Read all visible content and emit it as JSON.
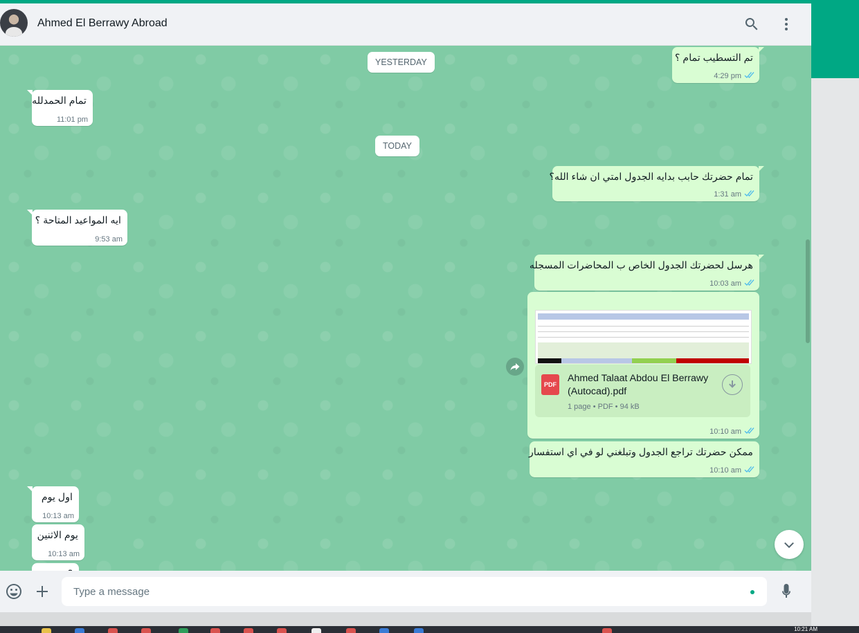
{
  "header": {
    "contact_name": "Ahmed El Berrawy Abroad",
    "icons": [
      "search-icon",
      "menu-icon"
    ]
  },
  "chat": {
    "date_yesterday": "YESTERDAY",
    "date_today": "TODAY",
    "messages": [
      {
        "direction": "out",
        "text": "تم التسطيب تمام ؟",
        "time": "4:29 pm",
        "status": "read"
      },
      {
        "direction": "in",
        "text": "تمام الحمدلله",
        "time": "11:01 pm"
      },
      {
        "direction": "out",
        "text": "تمام حضرتك حابب بدايه الجدول امتي ان شاء الله؟",
        "time": "1:31 am",
        "status": "read"
      },
      {
        "direction": "in",
        "text": "ايه المواعيد المتاحة ؟",
        "time": "9:53 am"
      },
      {
        "direction": "out",
        "text": "هرسل لحضرتك الجدول الخاص ب المحاضرات المسجله",
        "time": "10:03 am",
        "status": "read"
      },
      {
        "direction": "out",
        "type": "document",
        "file_name": "Ahmed Talaat Abdou El Berrawy (Autocad).pdf",
        "file_info": "1 page • PDF • 94 kB",
        "file_icon_label": "PDF",
        "time": "10:10 am",
        "status": "read"
      },
      {
        "direction": "out",
        "text": "ممكن حضرتك تراجع الجدول وتبلغني لو في اي استفسار",
        "time": "10:10 am",
        "status": "read"
      },
      {
        "direction": "in",
        "text": "اول يوم",
        "time": "10:13 am"
      },
      {
        "direction": "in",
        "text": "يوم الاثنين",
        "time": "10:13 am"
      },
      {
        "direction": "in",
        "text": "؟",
        "time": ""
      }
    ]
  },
  "footer": {
    "placeholder": "Type a message"
  },
  "taskbar": {
    "clock": "10:21 AM"
  },
  "colors": {
    "accent": "#00a884",
    "chat_bg": "#80cba5",
    "bubble_out": "#d9fdd3",
    "bubble_in": "#ffffff",
    "read_ticks": "#53bdeb"
  }
}
